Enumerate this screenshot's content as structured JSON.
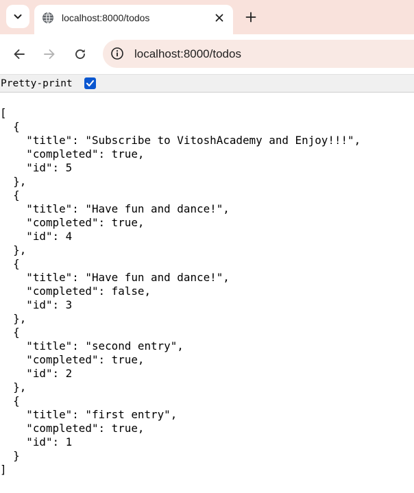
{
  "tab": {
    "title": "localhost:8000/todos",
    "favicon": "globe-icon"
  },
  "toolbar": {
    "url": "localhost:8000/todos",
    "back": "back-arrow-icon",
    "forward": "forward-arrow-icon",
    "reload": "reload-icon",
    "site_info": "site-info-icon"
  },
  "pretty_print": {
    "label": "Pretty-print",
    "checked": true
  },
  "json_lines": [
    "[",
    "  {",
    "    \"title\": \"Subscribe to VitoshAcademy and Enjoy!!!\",",
    "    \"completed\": true,",
    "    \"id\": 5",
    "  },",
    "  {",
    "    \"title\": \"Have fun and dance!\",",
    "    \"completed\": true,",
    "    \"id\": 4",
    "  },",
    "  {",
    "    \"title\": \"Have fun and dance!\",",
    "    \"completed\": false,",
    "    \"id\": 3",
    "  },",
    "  {",
    "    \"title\": \"second entry\",",
    "    \"completed\": true,",
    "    \"id\": 2",
    "  },",
    "  {",
    "    \"title\": \"first entry\",",
    "    \"completed\": true,",
    "    \"id\": 1",
    "  }",
    "]"
  ],
  "colors": {
    "tabstrip_bg": "#f9e2dc",
    "omnibox_bg": "#f9e9e4",
    "checkbox_accent": "#0b57d0"
  }
}
